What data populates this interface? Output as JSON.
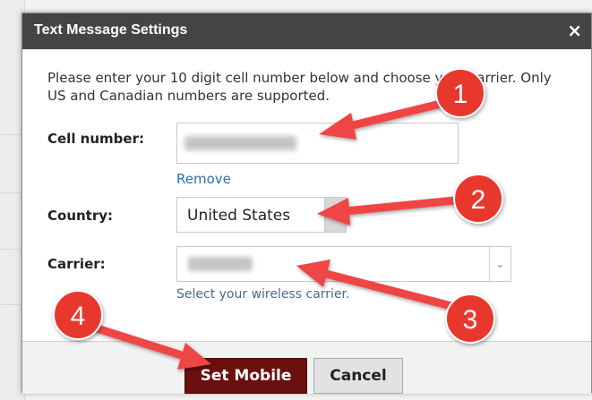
{
  "dialog": {
    "title": "Text Message Settings",
    "close_glyph": "×",
    "intro": "Please enter your 10 digit cell number below and choose your carrier. Only US and Canadian numbers are supported."
  },
  "form": {
    "cell_label": "Cell number:",
    "remove_link": "Remove",
    "country_label": "Country:",
    "country_value": "United States",
    "carrier_label": "Carrier:",
    "carrier_help": "Select your wireless carrier.",
    "carrier_arrow_glyph": "⌄"
  },
  "buttons": {
    "set_mobile": "Set Mobile",
    "cancel": "Cancel"
  },
  "annotations": {
    "badges": [
      "1",
      "2",
      "3",
      "4"
    ],
    "color": "#e8382f",
    "arrow_color": "#ee4444"
  }
}
